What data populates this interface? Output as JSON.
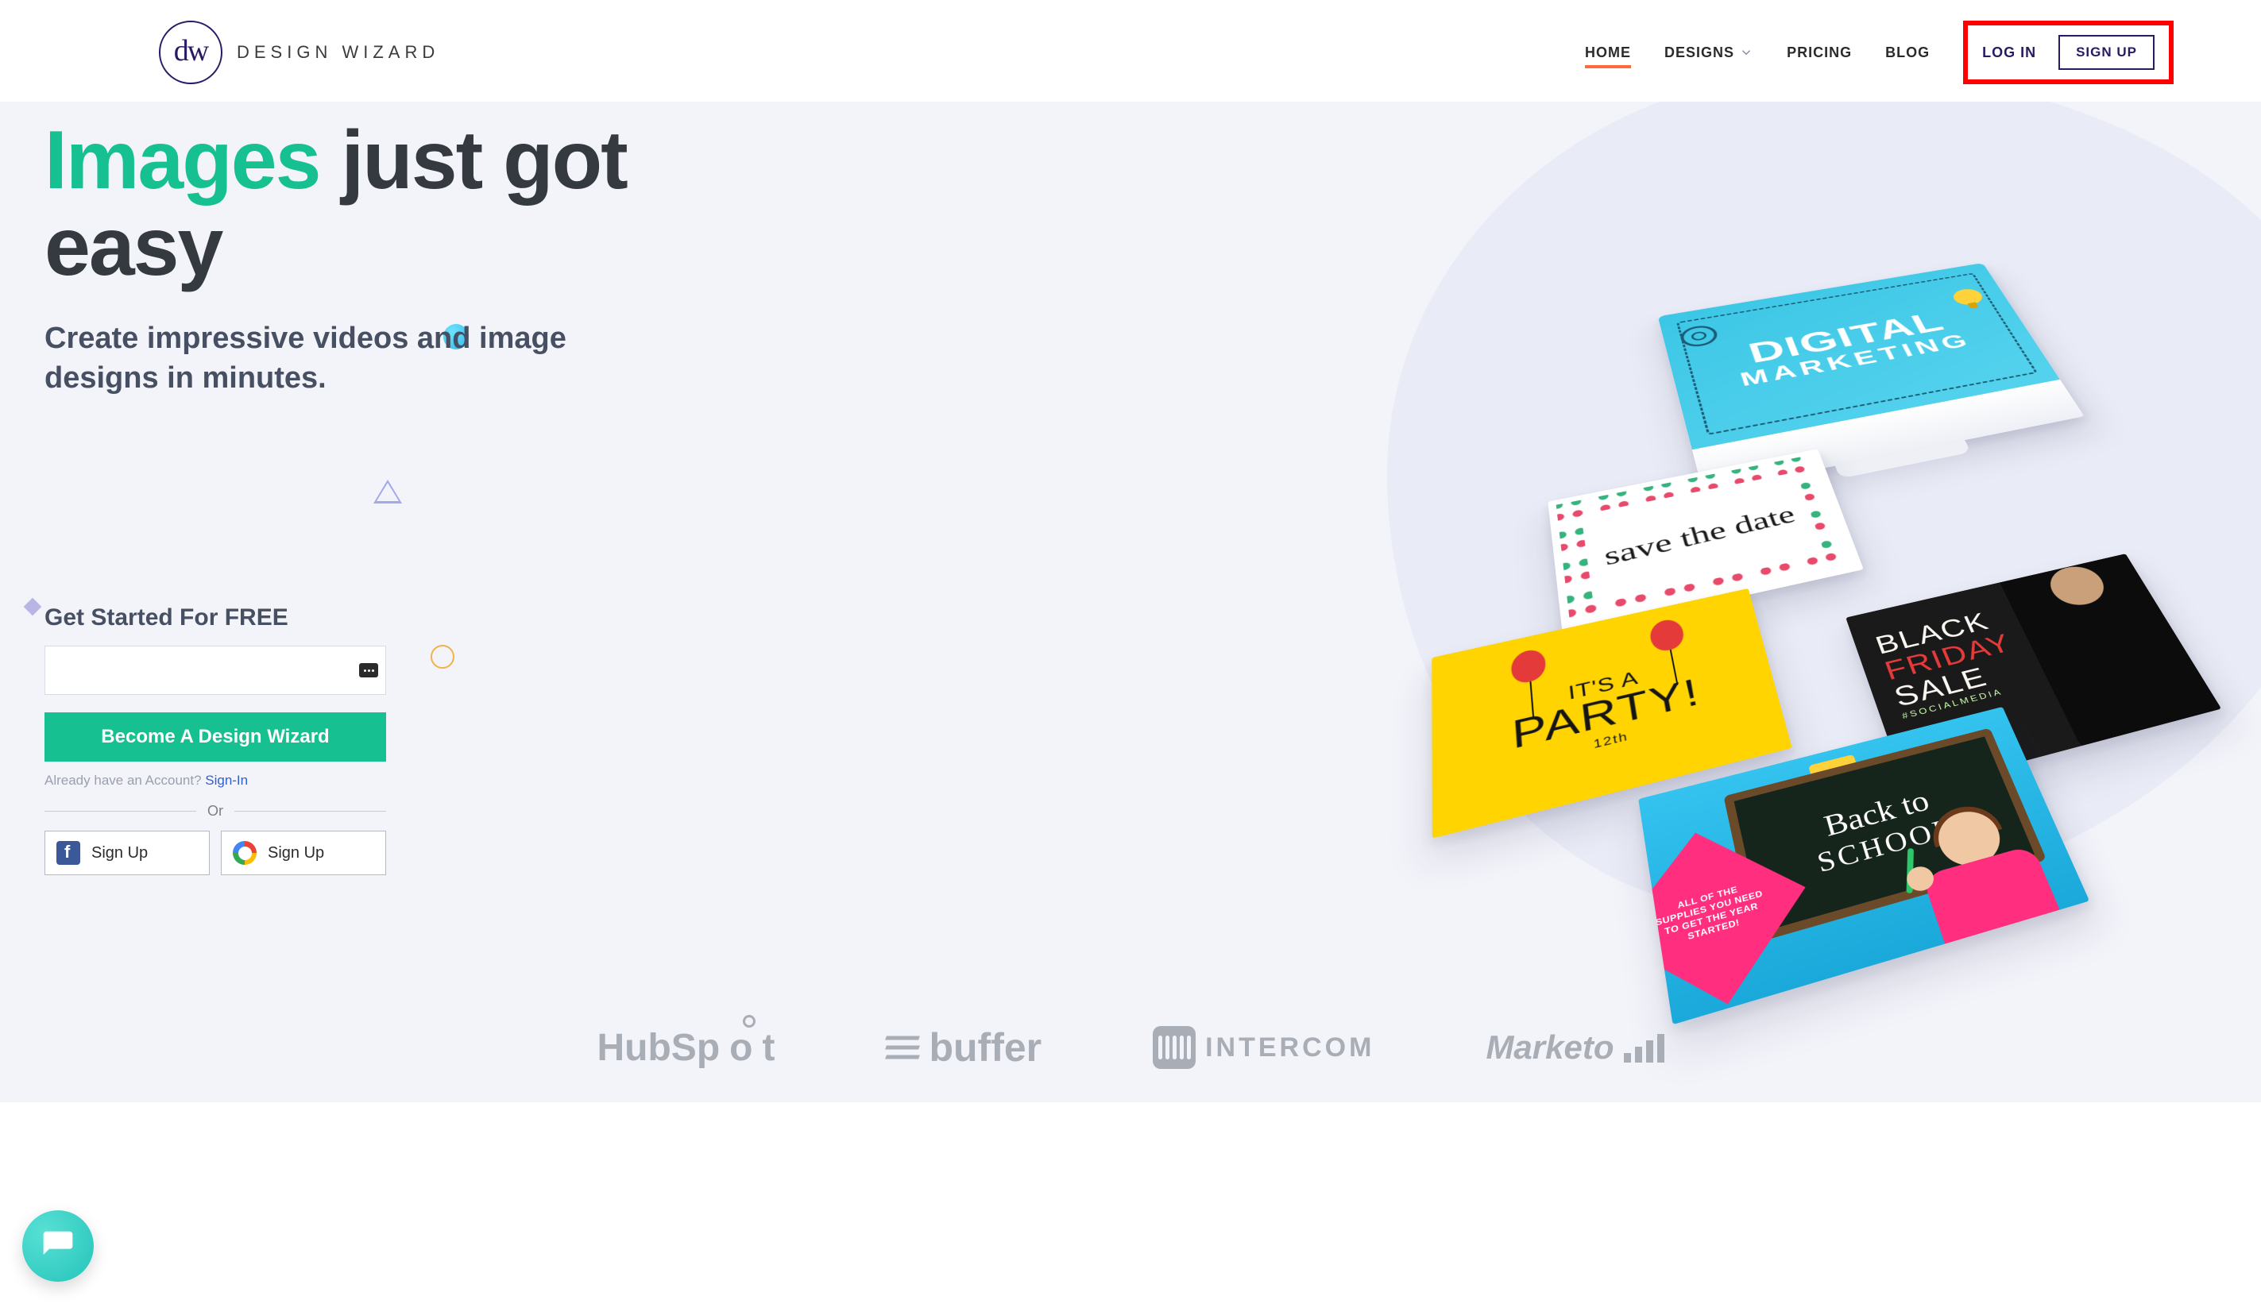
{
  "logo": {
    "mark": "dw",
    "text": "DESIGN WIZARD"
  },
  "nav": {
    "home": "HOME",
    "designs": "DESIGNS",
    "pricing": "PRICING",
    "blog": "BLOG",
    "login": "LOG IN",
    "signup": "SIGN UP"
  },
  "hero": {
    "accent": "Images",
    "rest": " just got easy",
    "sub": "Create impressive videos and image designs in minutes."
  },
  "signup": {
    "title": "Get Started For FREE",
    "cta": "Become A Design Wizard",
    "already": "Already have an Account? ",
    "signin": "Sign-In",
    "or": "Or",
    "fb": "Sign Up",
    "google": "Sign Up"
  },
  "cards": {
    "monitor1": "DIGITAL",
    "monitor2": "MARKETING",
    "savedate": "save the date",
    "party_its": "IT'S A",
    "party_word": "PARTY!",
    "party_date": "12th",
    "bfs_black": "BLACK",
    "bfs_friday": "FRIDAY",
    "bfs_sale": "SALE",
    "bfs_tag": "#SOCIALMEDIA",
    "school_cursive": "Back to",
    "school_block": "SCHOOL",
    "school_badge": "ALL OF THE SUPPLIES YOU NEED TO GET THE YEAR STARTED!"
  },
  "brands": {
    "hubspot": "HubSpot",
    "buffer": "buffer",
    "intercom": "INTERCOM",
    "marketo": "Marketo"
  }
}
